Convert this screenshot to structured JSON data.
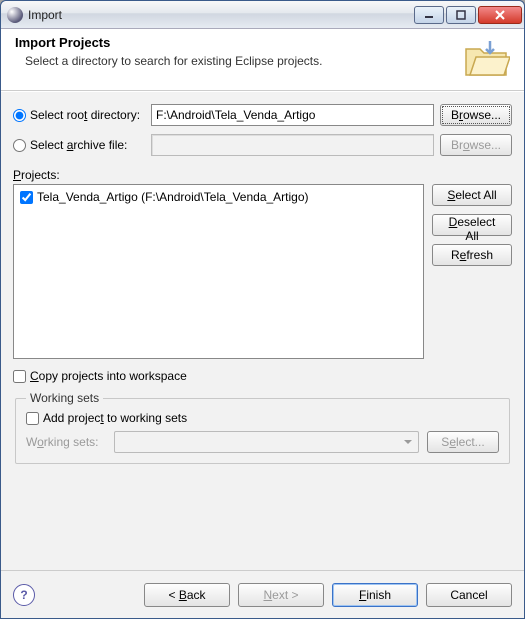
{
  "window": {
    "title": "Import"
  },
  "banner": {
    "heading": "Import Projects",
    "subtext": "Select a directory to search for existing Eclipse projects."
  },
  "source": {
    "root_radio_pre": "Select roo",
    "root_radio_u": "t",
    "root_radio_post": " directory:",
    "archive_radio_pre": "Select ",
    "archive_radio_u": "a",
    "archive_radio_post": "rchive file:",
    "root_value": "F:\\Android\\Tela_Venda_Artigo",
    "archive_value": "",
    "browse1_pre": "B",
    "browse1_u": "r",
    "browse1_post": "owse...",
    "browse2_pre": "Br",
    "browse2_u": "o",
    "browse2_post": "wse..."
  },
  "projects": {
    "label_u": "P",
    "label_post": "rojects:",
    "items": [
      {
        "checked": true,
        "label": "Tela_Venda_Artigo (F:\\Android\\Tela_Venda_Artigo)"
      }
    ],
    "select_all_u": "S",
    "select_all_post": "elect All",
    "deselect_all_u": "D",
    "deselect_all_post": "eselect All",
    "refresh_pre": "R",
    "refresh_u": "e",
    "refresh_post": "fresh"
  },
  "copy": {
    "label_u": "C",
    "label_post": "opy projects into workspace",
    "checked": false
  },
  "working_sets": {
    "legend": "Working sets",
    "add_pre": "Add projec",
    "add_u": "t",
    "add_post": " to working sets",
    "add_checked": false,
    "combo_label_pre": "W",
    "combo_label_u": "o",
    "combo_label_post": "rking sets:",
    "select_btn_pre": "S",
    "select_btn_u": "e",
    "select_btn_post": "lect..."
  },
  "footer": {
    "back_pre": "< ",
    "back_u": "B",
    "back_post": "ack",
    "next_u": "N",
    "next_post": "ext >",
    "finish_u": "F",
    "finish_post": "inish",
    "cancel": "Cancel"
  }
}
